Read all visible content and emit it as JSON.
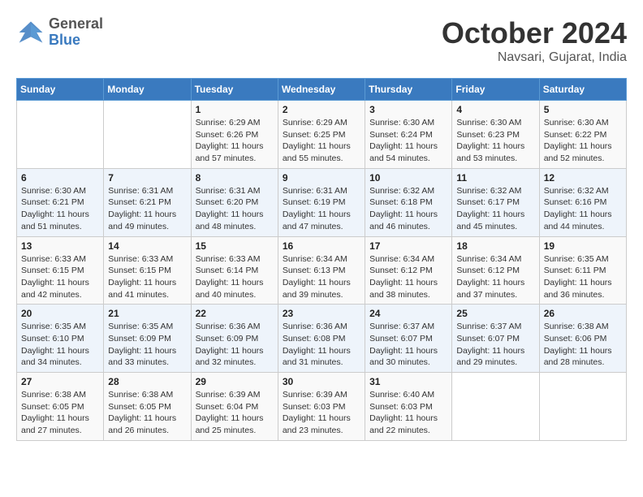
{
  "header": {
    "logo_line1": "General",
    "logo_line2": "Blue",
    "title": "October 2024",
    "subtitle": "Navsari, Gujarat, India"
  },
  "days_of_week": [
    "Sunday",
    "Monday",
    "Tuesday",
    "Wednesday",
    "Thursday",
    "Friday",
    "Saturday"
  ],
  "weeks": [
    [
      {
        "num": "",
        "sunrise": "",
        "sunset": "",
        "daylight": ""
      },
      {
        "num": "",
        "sunrise": "",
        "sunset": "",
        "daylight": ""
      },
      {
        "num": "1",
        "sunrise": "Sunrise: 6:29 AM",
        "sunset": "Sunset: 6:26 PM",
        "daylight": "Daylight: 11 hours and 57 minutes."
      },
      {
        "num": "2",
        "sunrise": "Sunrise: 6:29 AM",
        "sunset": "Sunset: 6:25 PM",
        "daylight": "Daylight: 11 hours and 55 minutes."
      },
      {
        "num": "3",
        "sunrise": "Sunrise: 6:30 AM",
        "sunset": "Sunset: 6:24 PM",
        "daylight": "Daylight: 11 hours and 54 minutes."
      },
      {
        "num": "4",
        "sunrise": "Sunrise: 6:30 AM",
        "sunset": "Sunset: 6:23 PM",
        "daylight": "Daylight: 11 hours and 53 minutes."
      },
      {
        "num": "5",
        "sunrise": "Sunrise: 6:30 AM",
        "sunset": "Sunset: 6:22 PM",
        "daylight": "Daylight: 11 hours and 52 minutes."
      }
    ],
    [
      {
        "num": "6",
        "sunrise": "Sunrise: 6:30 AM",
        "sunset": "Sunset: 6:21 PM",
        "daylight": "Daylight: 11 hours and 51 minutes."
      },
      {
        "num": "7",
        "sunrise": "Sunrise: 6:31 AM",
        "sunset": "Sunset: 6:21 PM",
        "daylight": "Daylight: 11 hours and 49 minutes."
      },
      {
        "num": "8",
        "sunrise": "Sunrise: 6:31 AM",
        "sunset": "Sunset: 6:20 PM",
        "daylight": "Daylight: 11 hours and 48 minutes."
      },
      {
        "num": "9",
        "sunrise": "Sunrise: 6:31 AM",
        "sunset": "Sunset: 6:19 PM",
        "daylight": "Daylight: 11 hours and 47 minutes."
      },
      {
        "num": "10",
        "sunrise": "Sunrise: 6:32 AM",
        "sunset": "Sunset: 6:18 PM",
        "daylight": "Daylight: 11 hours and 46 minutes."
      },
      {
        "num": "11",
        "sunrise": "Sunrise: 6:32 AM",
        "sunset": "Sunset: 6:17 PM",
        "daylight": "Daylight: 11 hours and 45 minutes."
      },
      {
        "num": "12",
        "sunrise": "Sunrise: 6:32 AM",
        "sunset": "Sunset: 6:16 PM",
        "daylight": "Daylight: 11 hours and 44 minutes."
      }
    ],
    [
      {
        "num": "13",
        "sunrise": "Sunrise: 6:33 AM",
        "sunset": "Sunset: 6:15 PM",
        "daylight": "Daylight: 11 hours and 42 minutes."
      },
      {
        "num": "14",
        "sunrise": "Sunrise: 6:33 AM",
        "sunset": "Sunset: 6:15 PM",
        "daylight": "Daylight: 11 hours and 41 minutes."
      },
      {
        "num": "15",
        "sunrise": "Sunrise: 6:33 AM",
        "sunset": "Sunset: 6:14 PM",
        "daylight": "Daylight: 11 hours and 40 minutes."
      },
      {
        "num": "16",
        "sunrise": "Sunrise: 6:34 AM",
        "sunset": "Sunset: 6:13 PM",
        "daylight": "Daylight: 11 hours and 39 minutes."
      },
      {
        "num": "17",
        "sunrise": "Sunrise: 6:34 AM",
        "sunset": "Sunset: 6:12 PM",
        "daylight": "Daylight: 11 hours and 38 minutes."
      },
      {
        "num": "18",
        "sunrise": "Sunrise: 6:34 AM",
        "sunset": "Sunset: 6:12 PM",
        "daylight": "Daylight: 11 hours and 37 minutes."
      },
      {
        "num": "19",
        "sunrise": "Sunrise: 6:35 AM",
        "sunset": "Sunset: 6:11 PM",
        "daylight": "Daylight: 11 hours and 36 minutes."
      }
    ],
    [
      {
        "num": "20",
        "sunrise": "Sunrise: 6:35 AM",
        "sunset": "Sunset: 6:10 PM",
        "daylight": "Daylight: 11 hours and 34 minutes."
      },
      {
        "num": "21",
        "sunrise": "Sunrise: 6:35 AM",
        "sunset": "Sunset: 6:09 PM",
        "daylight": "Daylight: 11 hours and 33 minutes."
      },
      {
        "num": "22",
        "sunrise": "Sunrise: 6:36 AM",
        "sunset": "Sunset: 6:09 PM",
        "daylight": "Daylight: 11 hours and 32 minutes."
      },
      {
        "num": "23",
        "sunrise": "Sunrise: 6:36 AM",
        "sunset": "Sunset: 6:08 PM",
        "daylight": "Daylight: 11 hours and 31 minutes."
      },
      {
        "num": "24",
        "sunrise": "Sunrise: 6:37 AM",
        "sunset": "Sunset: 6:07 PM",
        "daylight": "Daylight: 11 hours and 30 minutes."
      },
      {
        "num": "25",
        "sunrise": "Sunrise: 6:37 AM",
        "sunset": "Sunset: 6:07 PM",
        "daylight": "Daylight: 11 hours and 29 minutes."
      },
      {
        "num": "26",
        "sunrise": "Sunrise: 6:38 AM",
        "sunset": "Sunset: 6:06 PM",
        "daylight": "Daylight: 11 hours and 28 minutes."
      }
    ],
    [
      {
        "num": "27",
        "sunrise": "Sunrise: 6:38 AM",
        "sunset": "Sunset: 6:05 PM",
        "daylight": "Daylight: 11 hours and 27 minutes."
      },
      {
        "num": "28",
        "sunrise": "Sunrise: 6:38 AM",
        "sunset": "Sunset: 6:05 PM",
        "daylight": "Daylight: 11 hours and 26 minutes."
      },
      {
        "num": "29",
        "sunrise": "Sunrise: 6:39 AM",
        "sunset": "Sunset: 6:04 PM",
        "daylight": "Daylight: 11 hours and 25 minutes."
      },
      {
        "num": "30",
        "sunrise": "Sunrise: 6:39 AM",
        "sunset": "Sunset: 6:03 PM",
        "daylight": "Daylight: 11 hours and 23 minutes."
      },
      {
        "num": "31",
        "sunrise": "Sunrise: 6:40 AM",
        "sunset": "Sunset: 6:03 PM",
        "daylight": "Daylight: 11 hours and 22 minutes."
      },
      {
        "num": "",
        "sunrise": "",
        "sunset": "",
        "daylight": ""
      },
      {
        "num": "",
        "sunrise": "",
        "sunset": "",
        "daylight": ""
      }
    ]
  ]
}
